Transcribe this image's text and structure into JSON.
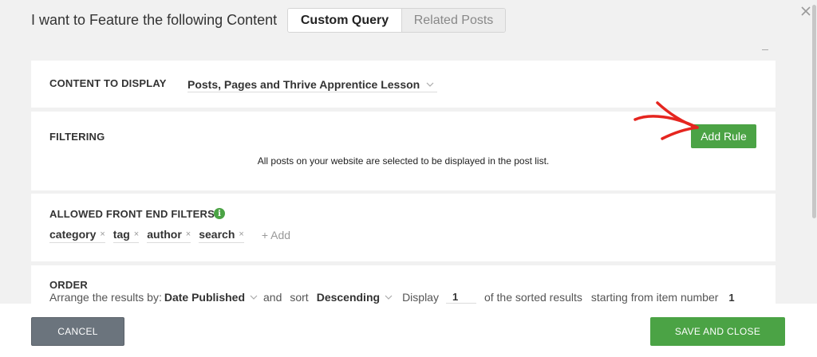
{
  "header": {
    "title": "I want to Feature the following Content",
    "tabs": [
      {
        "label": "Custom Query",
        "active": true
      },
      {
        "label": "Related Posts",
        "active": false
      }
    ]
  },
  "content": {
    "label": "CONTENT TO DISPLAY",
    "selected": "Posts, Pages and Thrive Apprentice Lesson"
  },
  "filtering": {
    "label": "FILTERING",
    "add_rule_label": "Add Rule",
    "message": "All posts on your website are selected to be displayed in the post list."
  },
  "front_end_filters": {
    "label": "ALLOWED FRONT END FILTERS",
    "tags": [
      "category",
      "tag",
      "author",
      "search"
    ],
    "remove_glyph": "×",
    "add_label": "+ Add"
  },
  "order": {
    "label": "ORDER",
    "arrange_text": "Arrange the results by:",
    "arrange_by": "Date Published",
    "and_text": "and",
    "sort_text": "sort",
    "sort_dir": "Descending",
    "display_text": "Display",
    "display_count": "1",
    "sorted_text": "of the sorted results",
    "starting_text": "starting from item number",
    "start_item": "1"
  },
  "footer": {
    "cancel_label": "CANCEL",
    "save_label": "SAVE AND CLOSE"
  },
  "colors": {
    "accent_green": "#4ba345",
    "cancel_gray": "#6b747d",
    "annotation_red": "#e5251f"
  },
  "icons": {
    "close": "close-icon",
    "chevron": "chevron-down-icon",
    "info": "info-icon",
    "annotation": "red-arrow-annotation"
  }
}
